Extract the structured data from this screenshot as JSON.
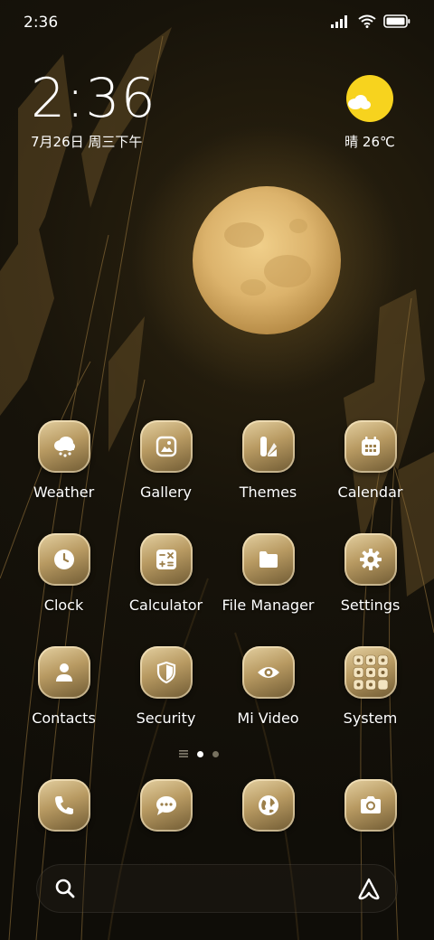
{
  "status_bar": {
    "time": "2:36",
    "icons": [
      "signal-icon",
      "wifi-icon",
      "battery-icon"
    ]
  },
  "clock_widget": {
    "time": "2:36",
    "date": "7月26日 周三下午"
  },
  "weather_widget": {
    "condition_temp": "晴 26℃",
    "icon": "sunny-cloud-icon"
  },
  "apps": [
    {
      "label": "Weather",
      "icon": "weather-icon"
    },
    {
      "label": "Gallery",
      "icon": "gallery-icon"
    },
    {
      "label": "Themes",
      "icon": "themes-icon"
    },
    {
      "label": "Calendar",
      "icon": "calendar-icon"
    },
    {
      "label": "Clock",
      "icon": "clock-icon"
    },
    {
      "label": "Calculator",
      "icon": "calculator-icon"
    },
    {
      "label": "File Manager",
      "icon": "folder-icon"
    },
    {
      "label": "Settings",
      "icon": "gear-icon"
    },
    {
      "label": "Contacts",
      "icon": "contacts-icon"
    },
    {
      "label": "Security",
      "icon": "shield-icon"
    },
    {
      "label": "Mi Video",
      "icon": "eye-icon"
    },
    {
      "label": "System",
      "icon": "folder-grid-icon"
    }
  ],
  "page_indicator": {
    "pages": 2,
    "current": 1
  },
  "dock": [
    {
      "icon": "phone-icon"
    },
    {
      "icon": "messages-icon"
    },
    {
      "icon": "browser-icon"
    },
    {
      "icon": "camera-icon"
    }
  ],
  "search_bar": {
    "icons": [
      "search-icon",
      "assistant-icon"
    ]
  },
  "colors": {
    "icon_gold_light": "#e4d0a1",
    "icon_gold_dark": "#6f5a33",
    "sun": "#f7d31e",
    "moon": "#d8b26a"
  }
}
